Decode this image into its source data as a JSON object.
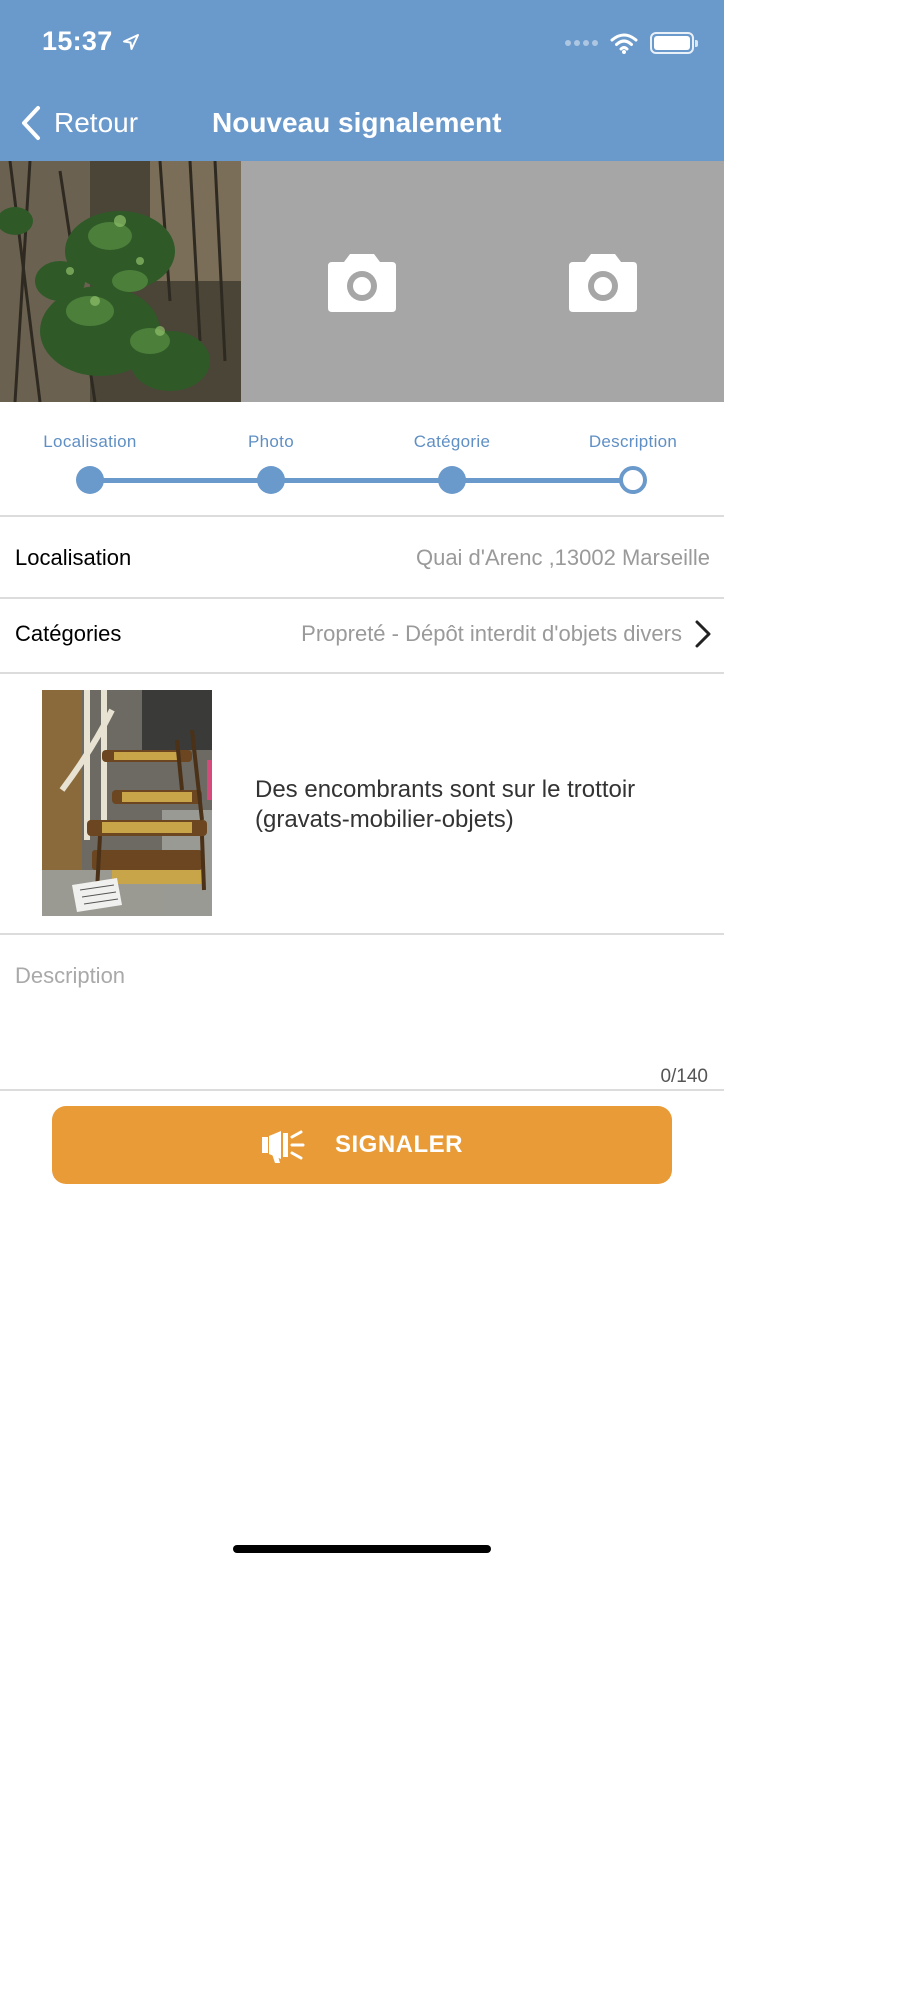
{
  "status_bar": {
    "time": "15:37"
  },
  "header": {
    "back_label": "Retour",
    "title": "Nouveau signalement"
  },
  "photos": [
    {
      "state": "filled",
      "subject": "foliage"
    },
    {
      "state": "empty",
      "icon": "camera-icon"
    },
    {
      "state": "empty",
      "icon": "camera-icon"
    }
  ],
  "steps": [
    {
      "label": "Localisation",
      "status": "done"
    },
    {
      "label": "Photo",
      "status": "done"
    },
    {
      "label": "Catégorie",
      "status": "done"
    },
    {
      "label": "Description",
      "status": "current"
    }
  ],
  "location": {
    "label": "Localisation",
    "value": "Quai d'Arenc ,13002 Marseille"
  },
  "categories": {
    "label": "Catégories",
    "value": "Propreté - Dépôt interdit d'objets divers"
  },
  "category_detail": {
    "text": "Des encombrants sont sur le trottoir (gravats-mobilier-objets)"
  },
  "description": {
    "placeholder": "Description",
    "value": "",
    "counter": "0/140"
  },
  "submit": {
    "label": "SIGNALER",
    "icon": "megaphone-icon"
  },
  "colors": {
    "header": "#6a99cb",
    "accent": "#e89b36",
    "step": "#6a99cb",
    "photo_placeholder": "#a6a6a6"
  }
}
